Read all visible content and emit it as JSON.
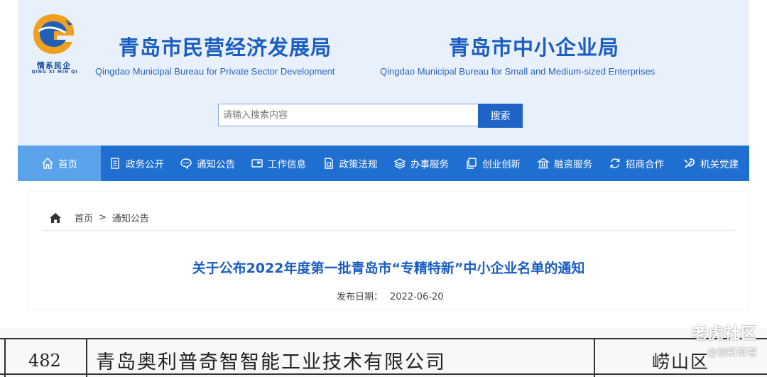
{
  "header": {
    "logo_cn": "情系民企",
    "logo_en": "QING XI MIN QI",
    "org1_cn": "青岛市民营经济发展局",
    "org1_en": "Qingdao Municipal Bureau for Private Sector Development",
    "org2_cn": "青岛市中小企业局",
    "org2_en": "Qingdao Municipal Bureau for Small and Medium-sized Enterprises"
  },
  "search": {
    "placeholder": "请输入搜索内容",
    "button": "搜索"
  },
  "nav": [
    {
      "label": "首页",
      "icon": "home-icon",
      "active": true
    },
    {
      "label": "政务公开",
      "icon": "document-icon"
    },
    {
      "label": "通知公告",
      "icon": "chat-icon"
    },
    {
      "label": "工作信息",
      "icon": "monitor-icon"
    },
    {
      "label": "政策法规",
      "icon": "file-icon"
    },
    {
      "label": "办事服务",
      "icon": "layers-icon"
    },
    {
      "label": "创业创新",
      "icon": "copy-icon"
    },
    {
      "label": "融资服务",
      "icon": "bank-icon"
    },
    {
      "label": "招商合作",
      "icon": "refresh-icon"
    },
    {
      "label": "机关党建",
      "icon": "party-icon"
    }
  ],
  "breadcrumb": {
    "home": "首页",
    "separator": ">",
    "current": "通知公告"
  },
  "article": {
    "title": "关于公布2022年度第一批青岛市“专精特新”中小企业名单的通知",
    "date_label": "发布日期：",
    "date": "2022-06-20"
  },
  "table_row": {
    "number": "482",
    "company": "青岛奥利普奇智智能工业技术有限公司",
    "district": "崂山区"
  },
  "watermark": {
    "main": "老虎社区",
    "sub": "@创新奇智"
  },
  "colors": {
    "primary": "#1e6fd0",
    "active": "#5aa2ea",
    "title": "#1b5ec2",
    "header_bg": "#e8f1fb"
  }
}
